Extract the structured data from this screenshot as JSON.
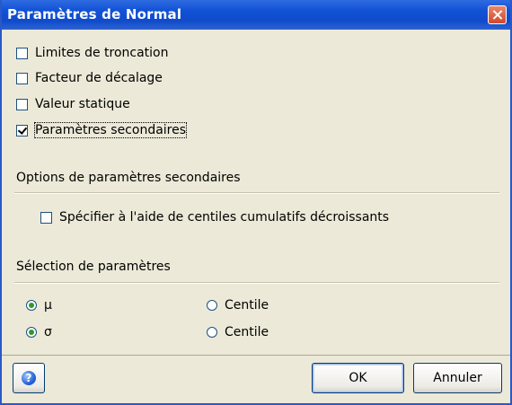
{
  "title": "Paramètres de Normal",
  "options": [
    {
      "label": "Limites de troncation",
      "checked": false
    },
    {
      "label": "Facteur de décalage",
      "checked": false
    },
    {
      "label": "Valeur statique",
      "checked": false
    },
    {
      "label": "Paramètres secondaires",
      "checked": true
    }
  ],
  "secondary": {
    "title": "Options de paramètres secondaires",
    "checkbox_label": "Spécifier à l'aide de centiles cumulatifs décroissants",
    "checked": false
  },
  "selection": {
    "title": "Sélection de paramètres",
    "rows": [
      {
        "param": "μ",
        "param_selected": true,
        "centile": "Centile",
        "centile_selected": false
      },
      {
        "param": "σ",
        "param_selected": true,
        "centile": "Centile",
        "centile_selected": false
      }
    ]
  },
  "buttons": {
    "ok": "OK",
    "cancel": "Annuler",
    "help_icon": "help-icon"
  },
  "colors": {
    "titlebar": "#0F4BCB",
    "face": "#ECE9D8",
    "radio_dot": "#2D9A2D"
  }
}
